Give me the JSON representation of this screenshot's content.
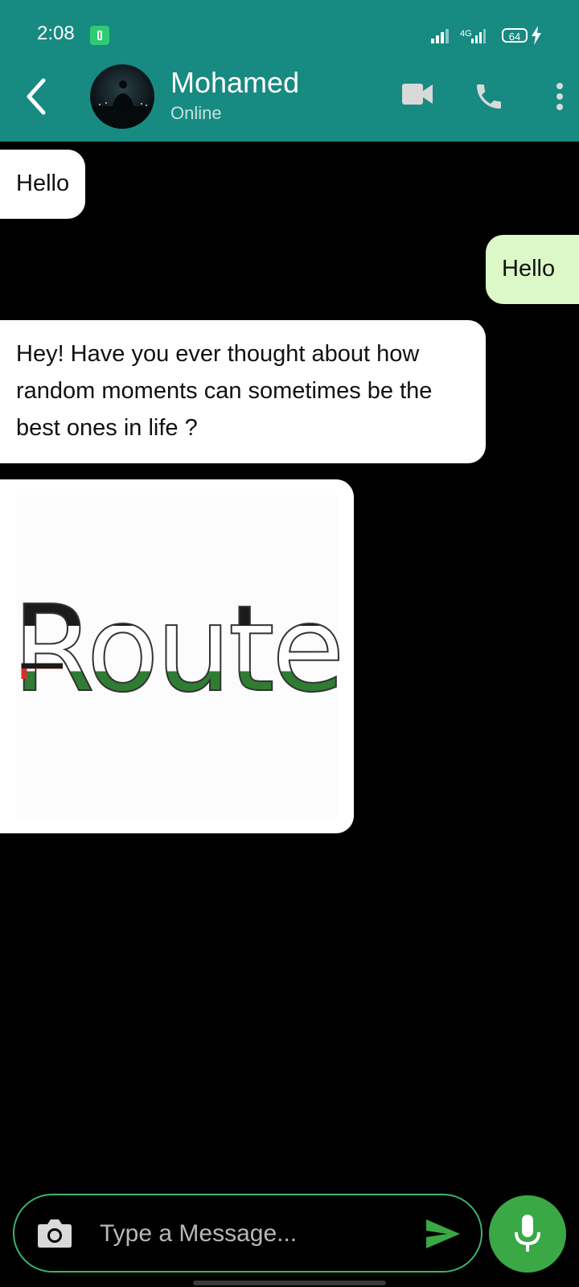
{
  "status_bar": {
    "time": "2:08",
    "network": "4G",
    "battery": "64"
  },
  "header": {
    "contact_name": "Mohamed",
    "contact_status": "Online"
  },
  "messages": [
    {
      "direction": "incoming",
      "text": "Hello"
    },
    {
      "direction": "outgoing",
      "text": "Hello"
    },
    {
      "direction": "incoming",
      "text": "Hey! Have you ever thought about how random moments can sometimes be the best ones in life ?"
    },
    {
      "direction": "incoming",
      "type": "image",
      "image_text": "Route"
    }
  ],
  "composer": {
    "placeholder": "Type a Message..."
  },
  "colors": {
    "header": "#178a82",
    "incoming_bubble": "#ffffff",
    "outgoing_bubble": "#dcf8c6",
    "accent": "#3aa845"
  }
}
